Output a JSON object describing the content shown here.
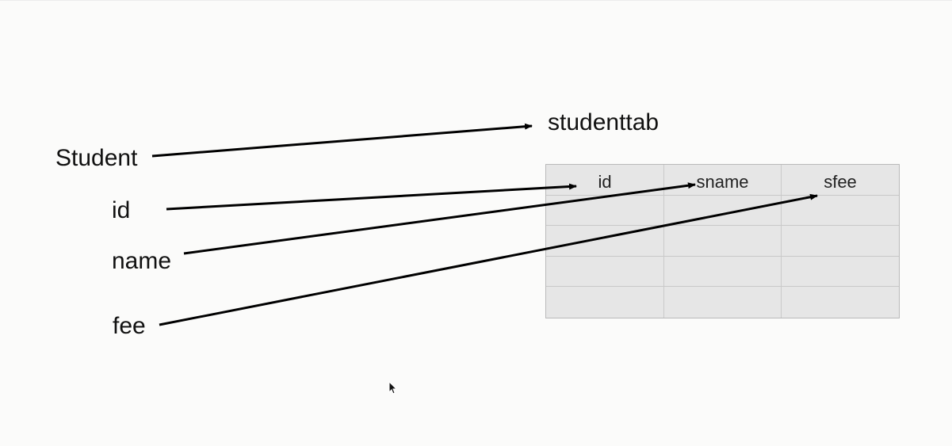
{
  "entity": {
    "class_name": "Student",
    "fields": [
      "id",
      "name",
      "fee"
    ]
  },
  "table": {
    "name": "studenttab",
    "columns": [
      "id",
      "sname",
      "sfee"
    ],
    "empty_rows": 4
  },
  "mappings": [
    {
      "from": "Student",
      "to": "studenttab"
    },
    {
      "from": "id",
      "to": "id"
    },
    {
      "from": "name",
      "to": "sname"
    },
    {
      "from": "fee",
      "to": "sfee"
    }
  ],
  "colors": {
    "background": "#fbfbfa",
    "table_fill": "#e6e6e6",
    "table_border": "#b9b9b9",
    "arrow": "#000000"
  },
  "icons": {
    "cursor": "mouse-pointer-icon"
  }
}
